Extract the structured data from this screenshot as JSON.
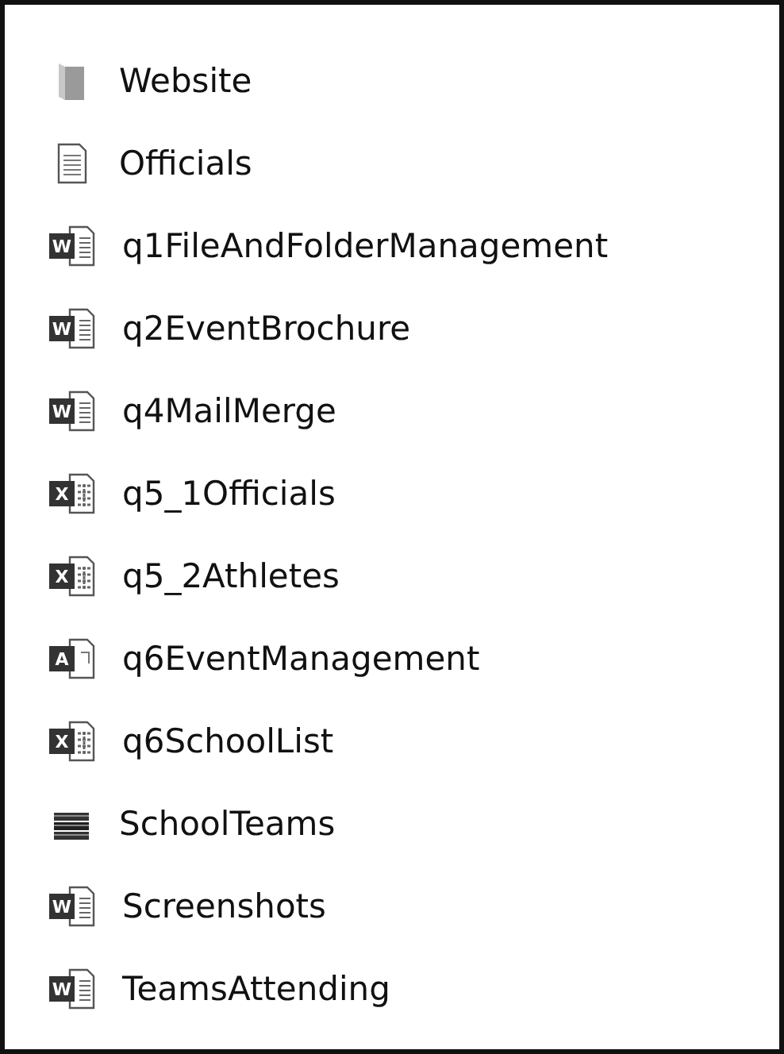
{
  "files": [
    {
      "name": "Website",
      "kind": "folder"
    },
    {
      "name": "Officials",
      "kind": "text"
    },
    {
      "name": "q1FileAndFolderManagement",
      "kind": "word",
      "badge": "W"
    },
    {
      "name": "q2EventBrochure",
      "kind": "word",
      "badge": "W"
    },
    {
      "name": "q4MailMerge",
      "kind": "word",
      "badge": "W"
    },
    {
      "name": "q5_1Officials",
      "kind": "excel",
      "badge": "X"
    },
    {
      "name": "q5_2Athletes",
      "kind": "excel",
      "badge": "X"
    },
    {
      "name": "q6EventManagement",
      "kind": "access",
      "badge": "A"
    },
    {
      "name": "q6SchoolList",
      "kind": "excel",
      "badge": "X"
    },
    {
      "name": "SchoolTeams",
      "kind": "archive"
    },
    {
      "name": "Screenshots",
      "kind": "word",
      "badge": "W"
    },
    {
      "name": "TeamsAttending",
      "kind": "word",
      "badge": "W"
    }
  ]
}
